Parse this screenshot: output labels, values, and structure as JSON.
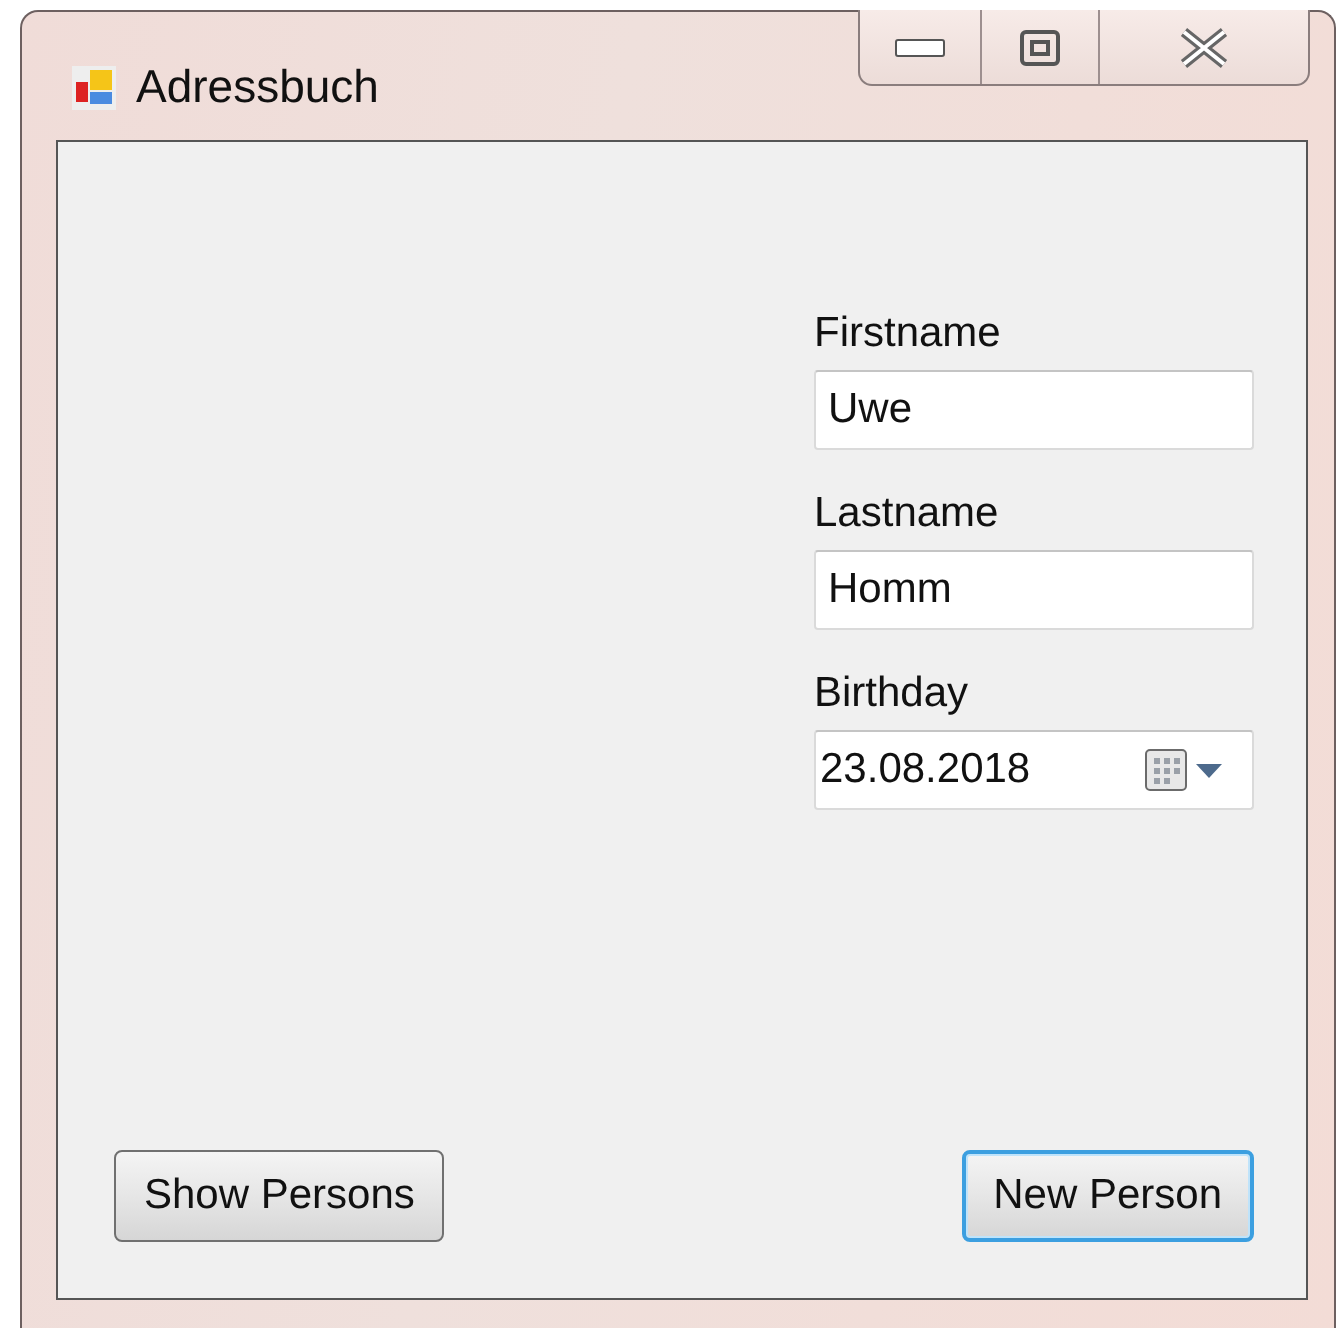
{
  "window": {
    "title": "Adressbuch"
  },
  "fields": [
    {
      "label": "Firstname",
      "value": "Uwe",
      "kind": "text"
    },
    {
      "label": "Lastname",
      "value": "Homm",
      "kind": "text"
    },
    {
      "label": "Birthday",
      "value": "23.08.2018",
      "kind": "date"
    }
  ],
  "buttons": [
    {
      "label": "Show Persons",
      "focused": false
    },
    {
      "label": "New Person",
      "focused": true
    }
  ]
}
